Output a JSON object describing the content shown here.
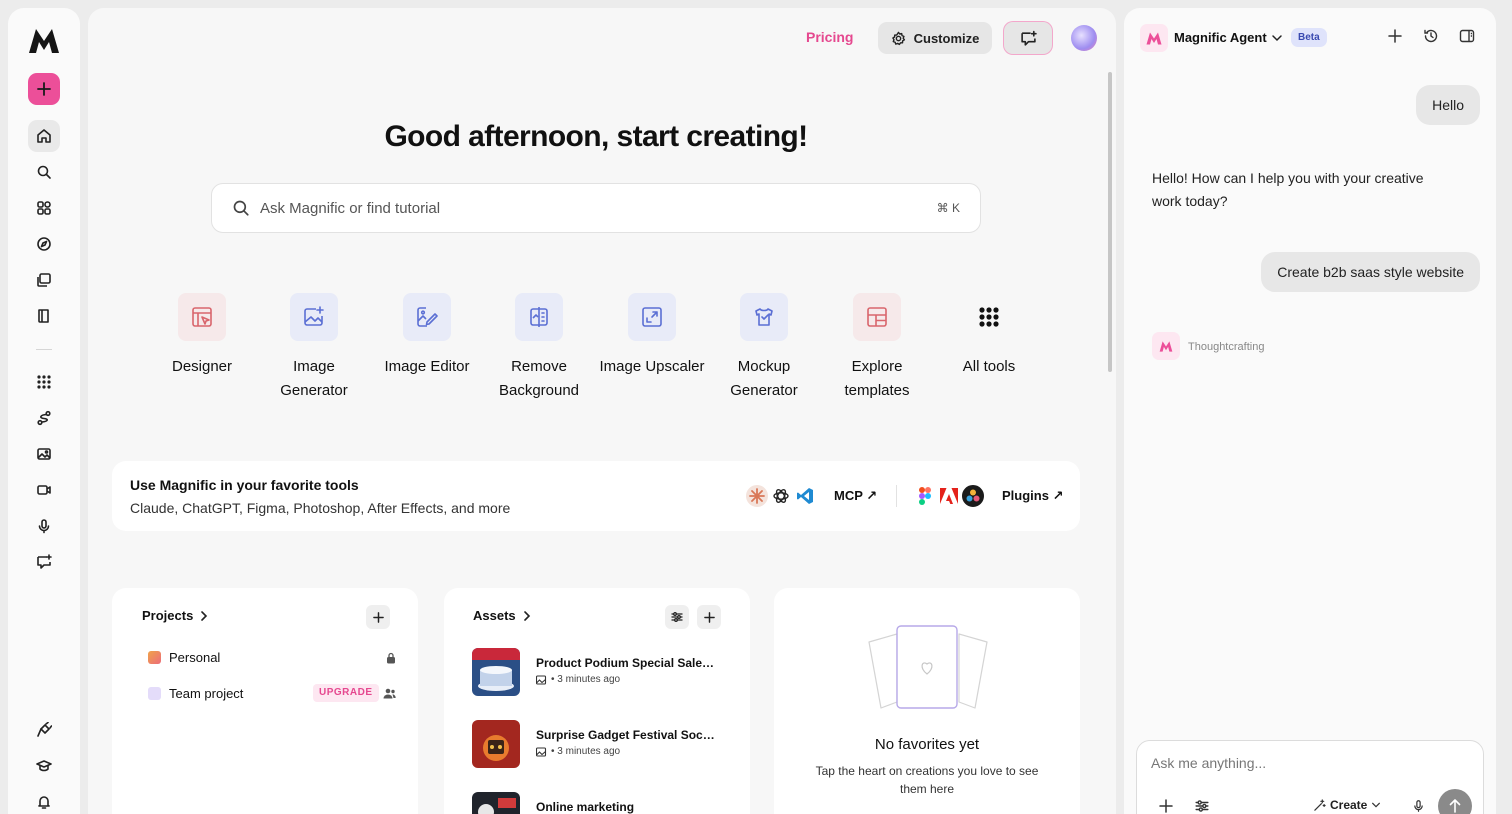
{
  "header": {
    "pricing": "Pricing",
    "customize": "Customize"
  },
  "main": {
    "greeting": "Good afternoon, start creating!",
    "search": {
      "placeholder": "Ask Magnific or find tutorial",
      "shortcut": "⌘ K"
    },
    "tools": [
      {
        "label": "Designer",
        "icon": "designer-icon"
      },
      {
        "label": "Image Generator",
        "icon": "image-generator-icon"
      },
      {
        "label": "Image Editor",
        "icon": "image-editor-icon"
      },
      {
        "label": "Remove Background",
        "icon": "remove-background-icon"
      },
      {
        "label": "Image Upscaler",
        "icon": "image-upscaler-icon"
      },
      {
        "label": "Mockup Generator",
        "icon": "mockup-generator-icon"
      },
      {
        "label": "Explore templates",
        "icon": "templates-icon"
      },
      {
        "label": "All tools",
        "icon": "grid-icon"
      }
    ],
    "integrations": {
      "title": "Use Magnific in your favorite tools",
      "subtitle": "Claude, ChatGPT, Figma, Photoshop, After Effects, and more",
      "mcp_label": "MCP",
      "plugins_label": "Plugins"
    },
    "projects": {
      "title": "Projects",
      "items": [
        {
          "name": "Personal"
        },
        {
          "name": "Team project",
          "badge": "UPGRADE"
        }
      ]
    },
    "assets": {
      "title": "Assets",
      "items": [
        {
          "name": "Product Podium Special Sale Banner",
          "meta": "• 3 minutes ago"
        },
        {
          "name": "Surprise Gadget Festival Social Post",
          "meta": "• 3 minutes ago"
        },
        {
          "name": "Online marketing",
          "meta": ""
        }
      ]
    },
    "favorites": {
      "title": "No favorites yet",
      "subtitle": "Tap the heart on creations you love to see them here"
    }
  },
  "agent": {
    "name": "Magnific Agent",
    "badge": "Beta",
    "messages": [
      {
        "role": "user",
        "text": "Hello"
      },
      {
        "role": "assistant",
        "text": "Hello! How can I help you with your creative work today?"
      },
      {
        "role": "user",
        "text": "Create b2b saas style website"
      }
    ],
    "status": "Thoughtcrafting",
    "input_placeholder": "Ask me anything...",
    "mode": "Create"
  },
  "colors": {
    "accent": "#ec4f99",
    "tool_tile": "#e8ebf8",
    "tool_tile_warm": "#f6e9ea",
    "tool_icon": "#5b6fd4",
    "tool_icon_warm": "#d9656c"
  }
}
